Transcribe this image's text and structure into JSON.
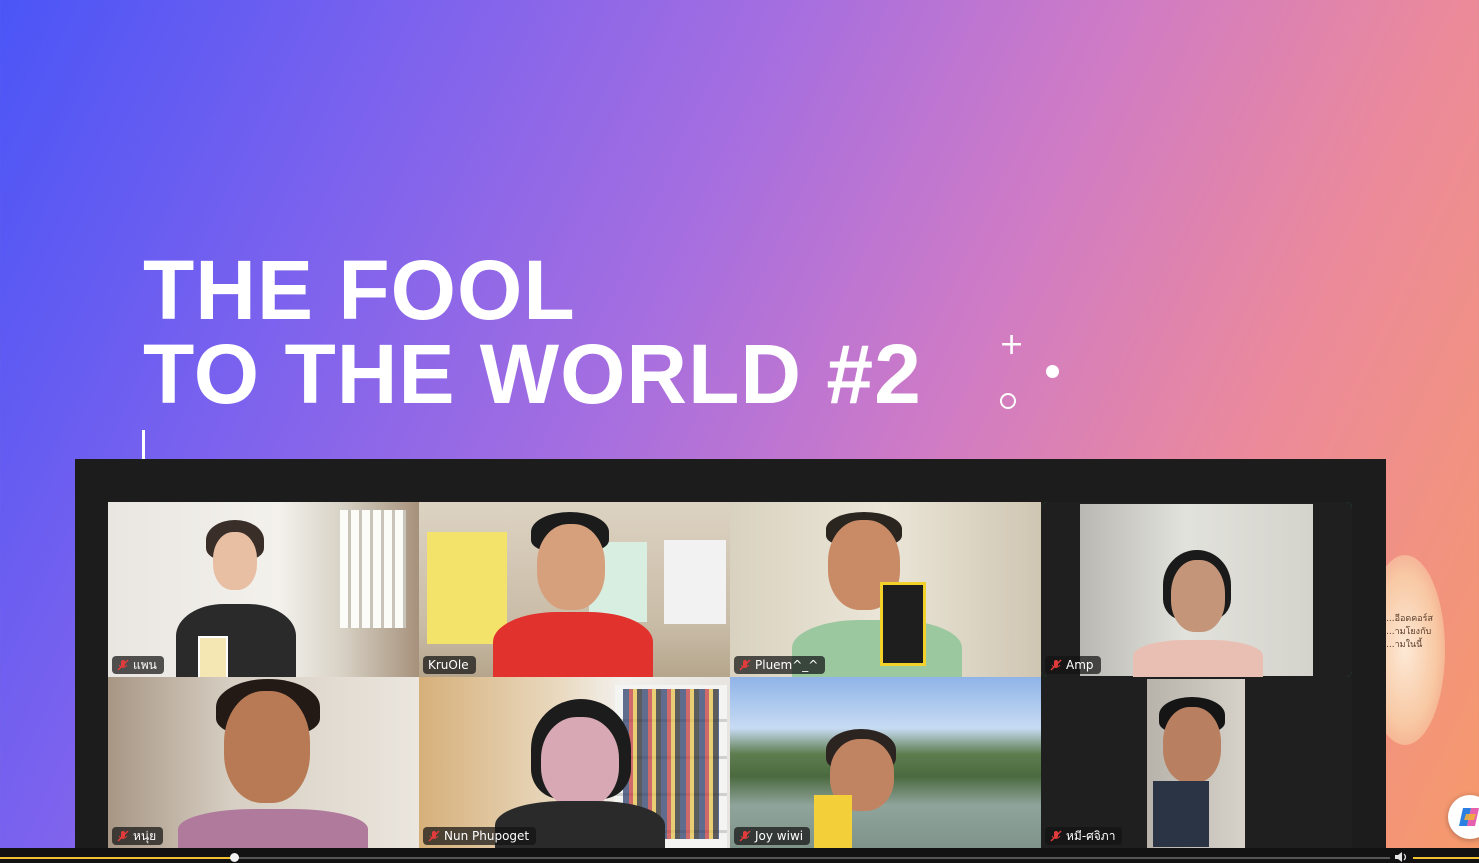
{
  "slide": {
    "title_line1": "THE FOOL",
    "title_line2": "TO THE WORLD #2",
    "side_card_text": [
      "...อีอดคอร์ส",
      "...ามโยงกับ",
      "...ามในนี้"
    ]
  },
  "meeting": {
    "active_speaker": "Amp",
    "participants": [
      {
        "name": "แพน",
        "muted": true
      },
      {
        "name": "KruOle",
        "muted": false
      },
      {
        "name": "Pluem^_^",
        "muted": true
      },
      {
        "name": "Amp",
        "muted": true
      },
      {
        "name": "หนุ่ย",
        "muted": true
      },
      {
        "name": "Nun Phupoget",
        "muted": true
      },
      {
        "name": "Joy wiwi",
        "muted": true
      },
      {
        "name": "หมี-ศจิภา",
        "muted": true
      }
    ]
  },
  "player": {
    "progress_fraction": 0.168,
    "accent_color": "#f2c230",
    "volume_icon": "volume-icon"
  },
  "colors": {
    "active_border": "#3ee07a",
    "gradient_start": "#4a55f6",
    "gradient_end": "#f69a6a"
  },
  "icons": {
    "mute": "mic-muted-icon",
    "assistant": "copilot-icon"
  }
}
